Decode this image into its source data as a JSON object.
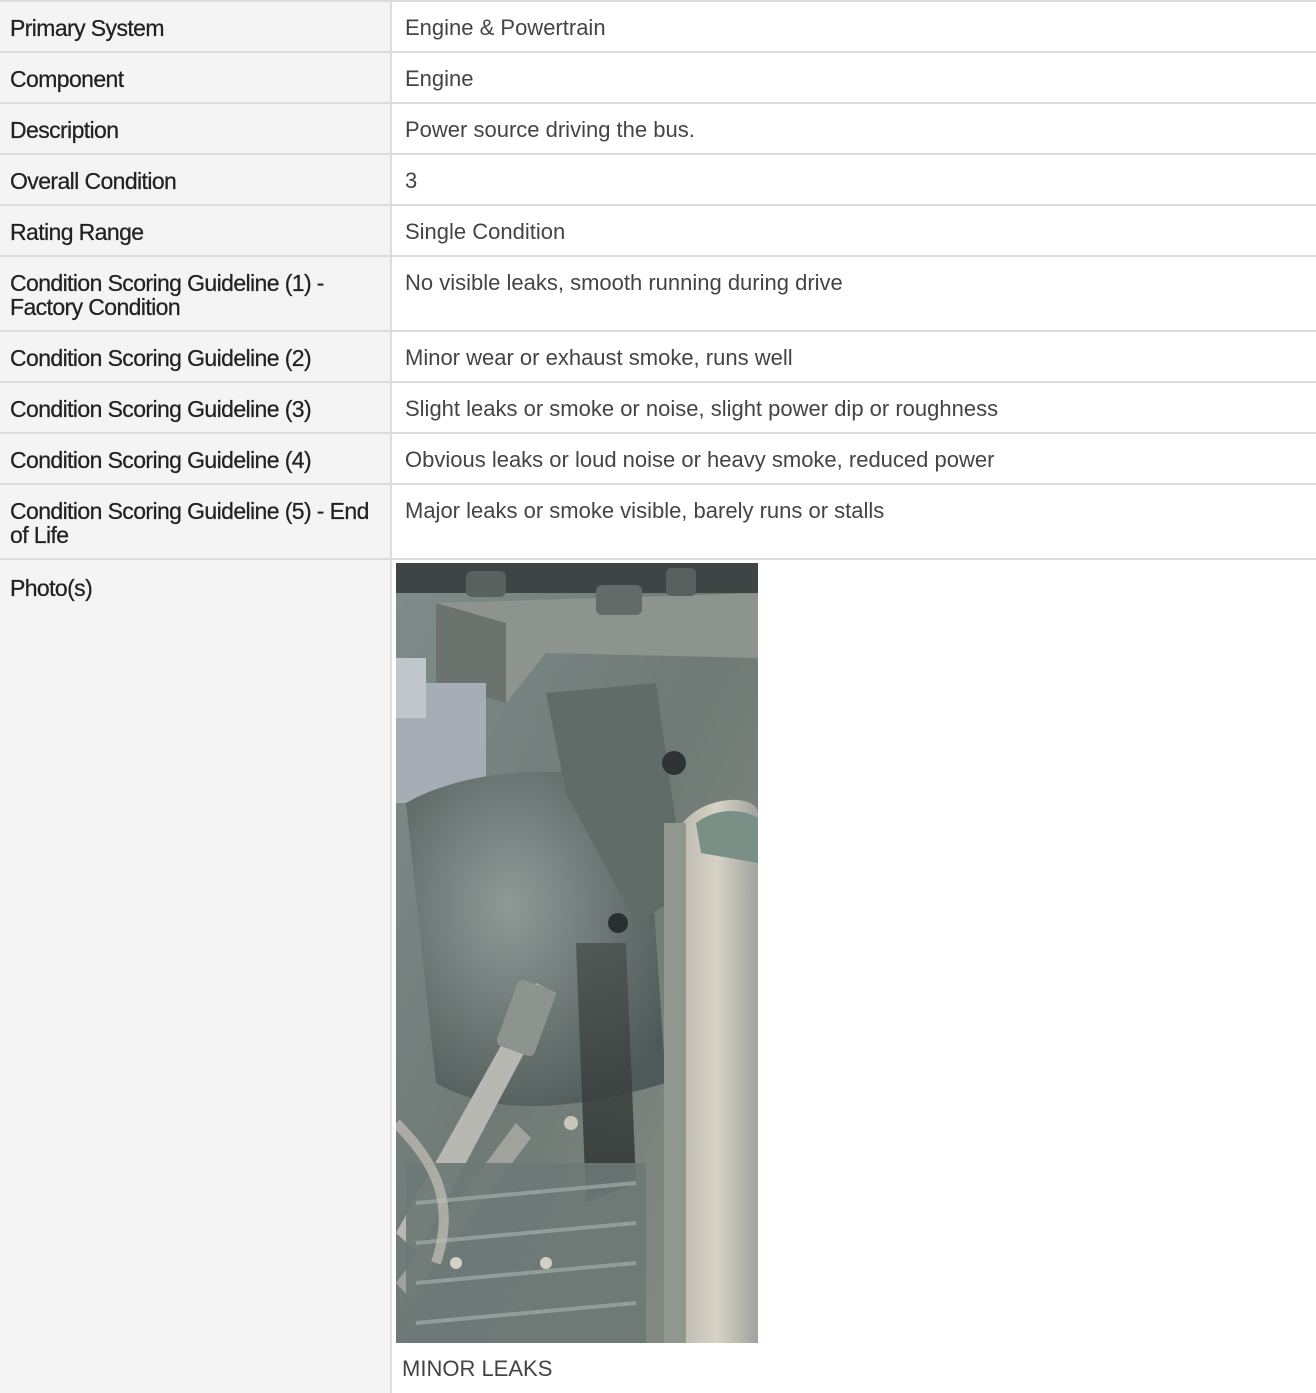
{
  "rows": [
    {
      "label": "Primary System",
      "value": "Engine & Powertrain"
    },
    {
      "label": "Component",
      "value": "Engine"
    },
    {
      "label": "Description",
      "value": "Power source driving the bus."
    },
    {
      "label": "Overall Condition",
      "value": "3"
    },
    {
      "label": "Rating Range",
      "value": "Single Condition"
    },
    {
      "label": "Condition Scoring Guideline (1) - Factory Condition",
      "value": "No visible leaks, smooth running during drive"
    },
    {
      "label": "Condition Scoring Guideline (2)",
      "value": "Minor wear or exhaust smoke, runs well"
    },
    {
      "label": "Condition Scoring Guideline (3)",
      "value": "Slight leaks or smoke or noise, slight power dip or roughness"
    },
    {
      "label": "Condition Scoring Guideline (4)",
      "value": "Obvious leaks or loud noise or heavy smoke, reduced power"
    },
    {
      "label": "Condition Scoring Guideline (5) - End of Life",
      "value": "Major leaks or smoke visible, barely runs or stalls"
    }
  ],
  "photos": {
    "label": "Photo(s)",
    "caption": "MINOR LEAKS"
  },
  "colors": {
    "label_bg": "#f4f4f4",
    "border": "#dcdcdc",
    "label_text": "#222222",
    "value_text": "#444444"
  }
}
